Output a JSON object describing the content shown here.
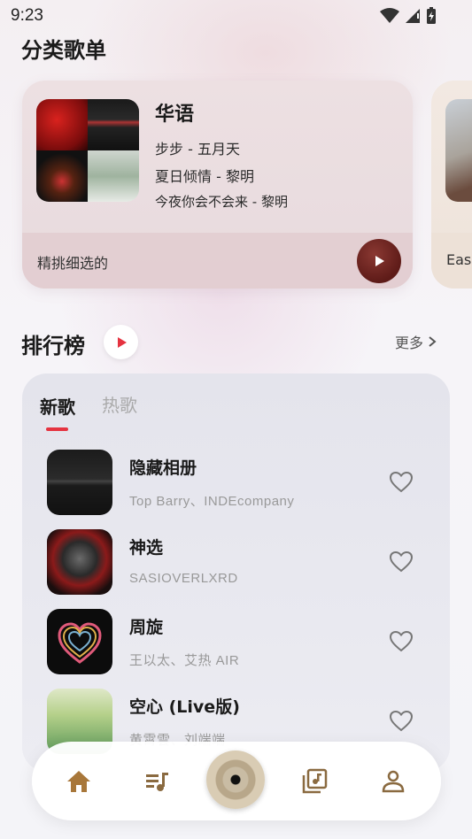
{
  "status_bar": {
    "time": "9:23"
  },
  "playlists": {
    "section_title": "分类歌单",
    "cards": [
      {
        "title": "华语",
        "songs": [
          "步步 - 五月天",
          "夏日倾情 - 黎明",
          "今夜你会不会来 - 黎明"
        ],
        "description": "精挑细选的"
      },
      {
        "description": "Eas"
      }
    ]
  },
  "ranking": {
    "section_title": "排行榜",
    "more_label": "更多",
    "tabs": [
      {
        "label": "新歌",
        "active": true
      },
      {
        "label": "热歌",
        "active": false
      }
    ],
    "songs": [
      {
        "title": "隐藏相册",
        "artist": "Top Barry、INDEcompany"
      },
      {
        "title": "神选",
        "artist": "SASIOVERLXRD"
      },
      {
        "title": "周旋",
        "artist": "王以太、艾热 AIR"
      },
      {
        "title": "空心 (Live版)",
        "artist": "黄霄雲、刘端端"
      }
    ]
  },
  "nav": {
    "items": [
      {
        "icon": "home-icon",
        "active": true
      },
      {
        "icon": "queue-music-icon",
        "active": false
      },
      {
        "icon": "now-playing-disc",
        "active": false
      },
      {
        "icon": "library-music-icon",
        "active": false
      },
      {
        "icon": "person-icon",
        "active": false
      }
    ]
  },
  "colors": {
    "accent_red": "#e53340",
    "nav_active": "#a8773a",
    "nav_inactive": "#8a6a40",
    "play_button": "#6e2520"
  }
}
